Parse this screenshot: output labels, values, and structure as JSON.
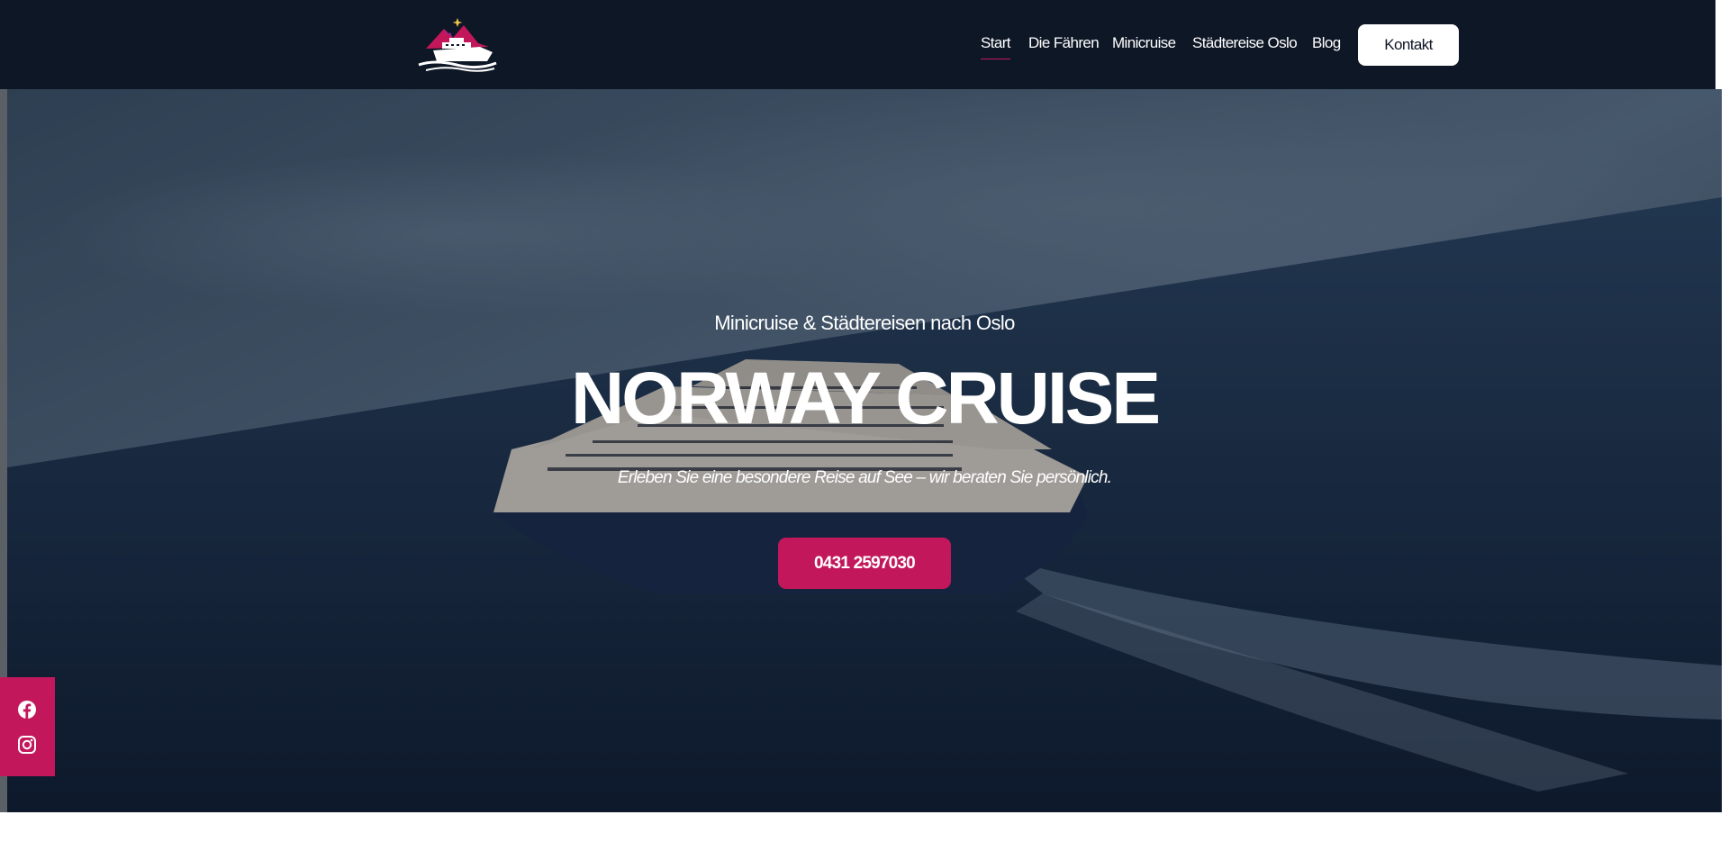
{
  "header": {
    "logo_name": "ship-mountain-logo",
    "nav": [
      {
        "label": "Start",
        "active": true
      },
      {
        "label": "Die Fähren",
        "active": false
      },
      {
        "label": "Minicruise",
        "active": false
      },
      {
        "label": "Städtereise Oslo",
        "active": false
      },
      {
        "label": "Blog",
        "active": false
      }
    ],
    "contact_label": "Kontakt"
  },
  "hero": {
    "kicker": "Minicruise & Städtereisen nach Oslo",
    "title": "NORWAY CRUISE",
    "tagline": "Erleben Sie eine besondere Reise auf See – wir beraten Sie persönlich.",
    "phone_label": "0431 2597030",
    "background_image": "ferry-at-sea"
  },
  "social": {
    "icons": [
      "facebook-icon",
      "instagram-icon"
    ]
  },
  "colors": {
    "header_bg": "#0e1726",
    "accent": "#c2185b",
    "white": "#ffffff"
  }
}
